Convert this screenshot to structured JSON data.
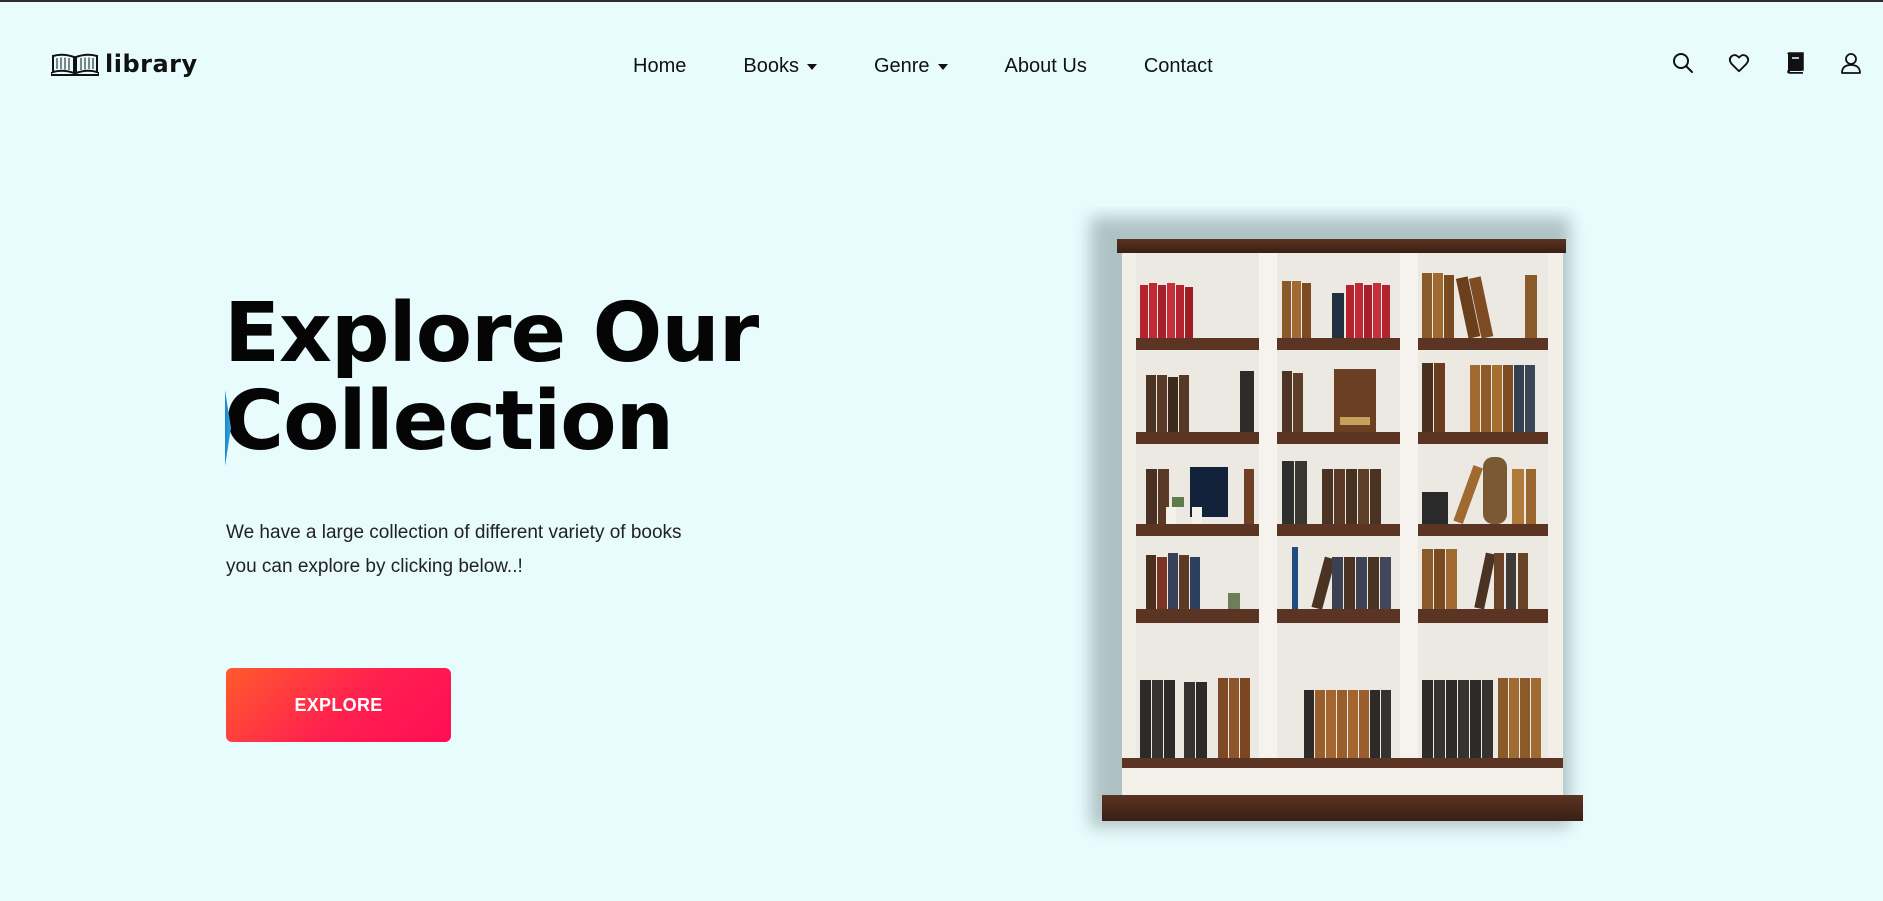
{
  "brand": {
    "name": "library",
    "icon": "open-book-icon"
  },
  "nav": {
    "items": [
      {
        "label": "Home",
        "has_dropdown": false
      },
      {
        "label": "Books",
        "has_dropdown": true
      },
      {
        "label": "Genre",
        "has_dropdown": true
      },
      {
        "label": "About Us",
        "has_dropdown": false
      },
      {
        "label": "Contact",
        "has_dropdown": false
      }
    ]
  },
  "header_icons": [
    "search-icon",
    "heart-icon",
    "book-icon",
    "user-icon"
  ],
  "hero": {
    "title_line1": "Explore Our",
    "title_line2": "Collection",
    "description": "We have a large collection of different variety of books you can explore by clicking below..!",
    "button_label": "EXPLORE"
  },
  "colors": {
    "background": "#e8fcfe",
    "button_gradient_start": "#ff5a2c",
    "button_gradient_end": "#ff0d55",
    "text": "#050505"
  }
}
